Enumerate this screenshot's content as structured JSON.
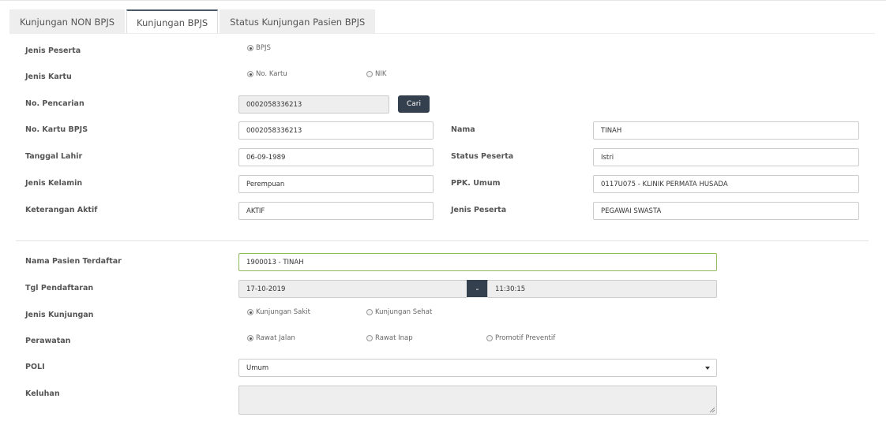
{
  "tabs": [
    {
      "label": "Kunjungan NON BPJS",
      "active": false
    },
    {
      "label": "Kunjungan BPJS",
      "active": true
    },
    {
      "label": "Status Kunjungan Pasien BPJS",
      "active": false
    }
  ],
  "peserta": {
    "jenis_peserta_label": "Jenis Peserta",
    "jenis_peserta_options": [
      {
        "label": "BPJS",
        "checked": true
      }
    ],
    "jenis_kartu_label": "Jenis Kartu",
    "jenis_kartu_options": [
      {
        "label": "No. Kartu",
        "checked": true
      },
      {
        "label": "NIK",
        "checked": false
      }
    ],
    "no_pencarian_label": "No. Pencarian",
    "no_pencarian_value": "0002058336213",
    "cari_label": "Cari",
    "no_kartu_label": "No. Kartu BPJS",
    "no_kartu_value": "0002058336213",
    "nama_label": "Nama",
    "nama_value": "TINAH",
    "tgl_lahir_label": "Tanggal Lahir",
    "tgl_lahir_value": "06-09-1989",
    "status_peserta_label": "Status Peserta",
    "status_peserta_value": "Istri",
    "jenis_kelamin_label": "Jenis Kelamin",
    "jenis_kelamin_value": "Perempuan",
    "ppk_label": "PPK. Umum",
    "ppk_value": "0117U075 - KLINIK PERMATA HUSADA",
    "ket_aktif_label": "Keterangan Aktif",
    "ket_aktif_value": "AKTIF",
    "jenis_peserta2_label": "Jenis Peserta",
    "jenis_peserta2_value": "PEGAWAI SWASTA"
  },
  "kunjungan": {
    "nama_pasien_label": "Nama Pasien Terdaftar",
    "nama_pasien_value": "1900013 - TINAH",
    "tgl_label": "Tgl Pendaftaran",
    "tgl_date": "17-10-2019",
    "tgl_sep": "-",
    "tgl_time": "11:30:15",
    "jenis_kunjungan_label": "Jenis Kunjungan",
    "jenis_kunjungan_options": [
      {
        "label": "Kunjungan Sakit",
        "checked": true
      },
      {
        "label": "Kunjungan Sehat",
        "checked": false
      }
    ],
    "perawatan_label": "Perawatan",
    "perawatan_options": [
      {
        "label": "Rawat Jalan",
        "checked": true
      },
      {
        "label": "Rawat Inap",
        "checked": false
      },
      {
        "label": "Promotif Preventif",
        "checked": false
      }
    ],
    "poli_label": "POLI",
    "poli_value": "Umum",
    "keluhan_label": "Keluhan",
    "keluhan_value": ""
  },
  "colors": {
    "button_dark": "#34404d",
    "focus_border": "#8fba5a",
    "readonly_bg": "#eeeeee"
  }
}
